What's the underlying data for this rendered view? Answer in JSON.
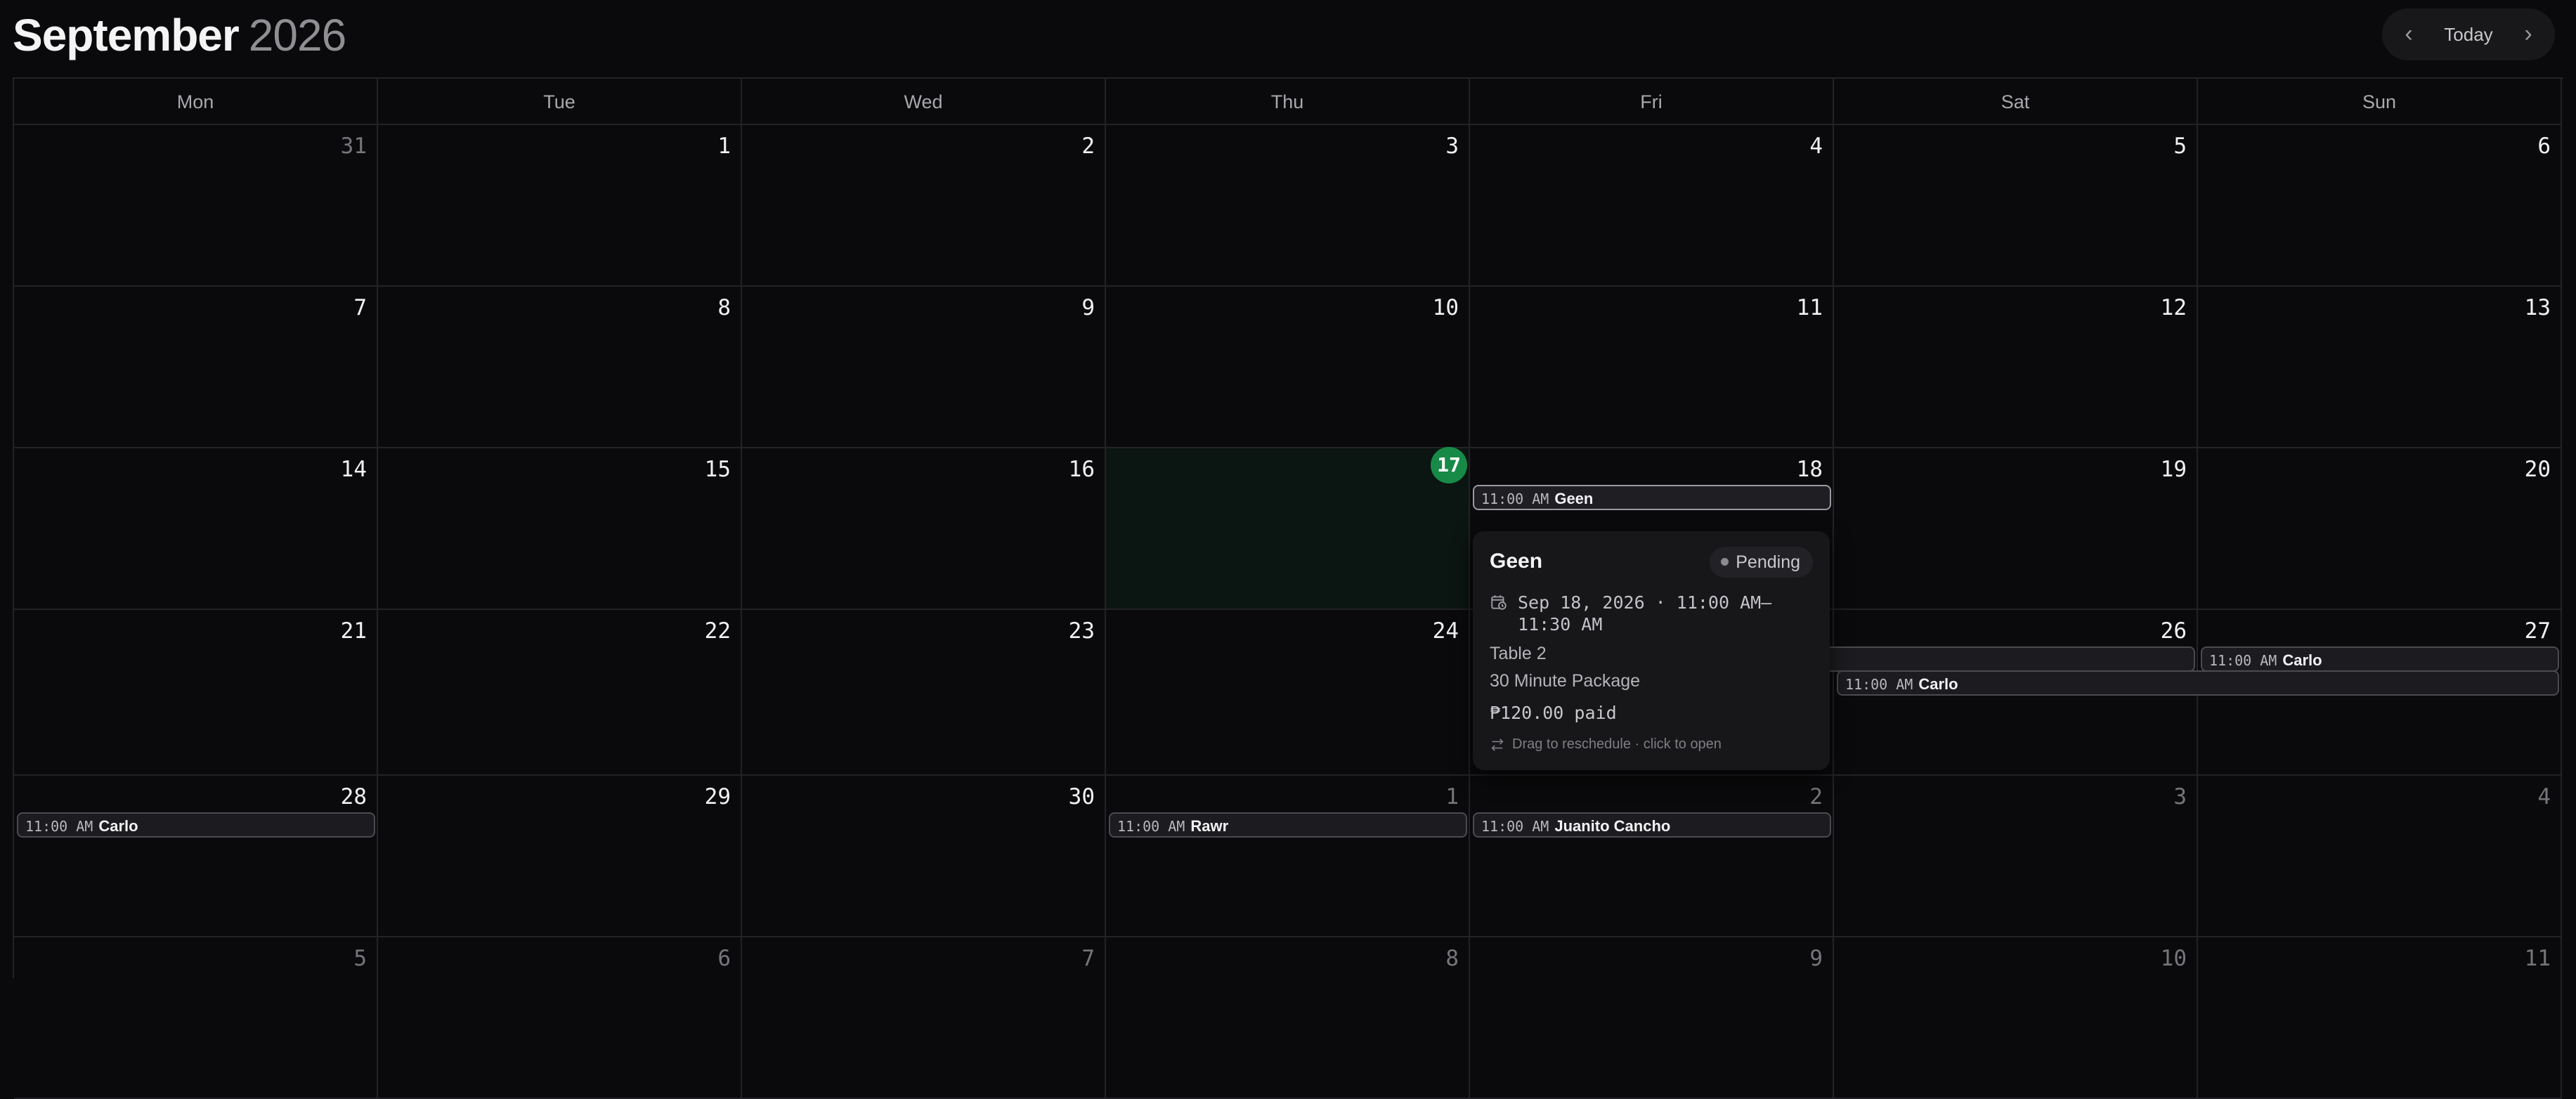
{
  "header": {
    "month": "September",
    "year": "2026",
    "nav": {
      "prev_icon": "chevron-left-icon",
      "today_label": "Today",
      "next_icon": "chevron-right-icon"
    }
  },
  "weekdays": [
    "Mon",
    "Tue",
    "Wed",
    "Thu",
    "Fri",
    "Sat",
    "Sun"
  ],
  "weeks": [
    [
      {
        "day": "31",
        "out": true
      },
      {
        "day": "1"
      },
      {
        "day": "2"
      },
      {
        "day": "3"
      },
      {
        "day": "4"
      },
      {
        "day": "5"
      },
      {
        "day": "6"
      }
    ],
    [
      {
        "day": "7"
      },
      {
        "day": "8"
      },
      {
        "day": "9"
      },
      {
        "day": "10"
      },
      {
        "day": "11"
      },
      {
        "day": "12"
      },
      {
        "day": "13"
      }
    ],
    [
      {
        "day": "14"
      },
      {
        "day": "15"
      },
      {
        "day": "16"
      },
      {
        "day": "17",
        "today": true
      },
      {
        "day": "18"
      },
      {
        "day": "19"
      },
      {
        "day": "20"
      }
    ],
    [
      {
        "day": "21"
      },
      {
        "day": "22"
      },
      {
        "day": "23"
      },
      {
        "day": "24"
      },
      {
        "day": "25"
      },
      {
        "day": "26"
      },
      {
        "day": "27"
      }
    ],
    [
      {
        "day": "28"
      },
      {
        "day": "29"
      },
      {
        "day": "30"
      },
      {
        "day": "1",
        "out": true
      },
      {
        "day": "2",
        "out": true
      },
      {
        "day": "3",
        "out": true
      },
      {
        "day": "4",
        "out": true
      }
    ],
    [
      {
        "day": "5",
        "out": true
      },
      {
        "day": "6",
        "out": true
      },
      {
        "day": "7",
        "out": true
      },
      {
        "day": "8",
        "out": true
      },
      {
        "day": "9",
        "out": true
      },
      {
        "day": "10",
        "out": true
      },
      {
        "day": "11",
        "out": true
      }
    ]
  ],
  "events": [
    {
      "week": 2,
      "col": 4,
      "span": 1,
      "lane": 0,
      "time": "11:00 AM",
      "name": "Geen",
      "selected": true
    },
    {
      "week": 3,
      "col": 4,
      "span": 2,
      "lane": 0,
      "time": "11:00 AM",
      "name": "Carlo"
    },
    {
      "week": 3,
      "col": 6,
      "span": 1,
      "lane": 0,
      "time": "11:00 AM",
      "name": "Carlo"
    },
    {
      "week": 3,
      "col": 5,
      "span": 2,
      "lane": 1,
      "time": "11:00 AM",
      "name": "Carlo"
    },
    {
      "week": 4,
      "col": 0,
      "span": 1,
      "lane": 0,
      "time": "11:00 AM",
      "name": "Carlo"
    },
    {
      "week": 4,
      "col": 3,
      "span": 1,
      "lane": 0,
      "time": "11:00 AM",
      "name": "Rawr"
    },
    {
      "week": 4,
      "col": 4,
      "span": 1,
      "lane": 0,
      "time": "11:00 AM",
      "name": "Juanito Cancho"
    }
  ],
  "popover": {
    "name": "Geen",
    "status": "Pending",
    "date_icon": "calendar-clock-icon",
    "date": "Sep 18, 2026 · 11:00 AM–11:30 AM",
    "table": "Table 2",
    "package": "30 Minute Package",
    "paid": "₱120.00 paid",
    "hint_icon": "swap-arrows-icon",
    "hint": "Drag to reschedule · click to open"
  }
}
